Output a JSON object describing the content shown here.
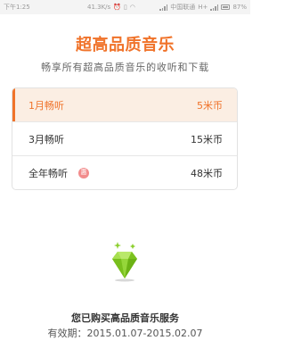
{
  "status_bar": {
    "time": "下午1:25",
    "network_speed": "41.3K/s",
    "carrier": "中国联通",
    "network_type": "H+",
    "battery": "87%"
  },
  "header": {
    "title": "超高品质音乐",
    "subtitle": "畅享所有超高品质音乐的收听和下载"
  },
  "options": [
    {
      "label": "1月畅听",
      "price": "5米币",
      "selected": true
    },
    {
      "label": "3月畅听",
      "price": "15米币",
      "selected": false
    },
    {
      "label": "全年畅听",
      "price": "48米币",
      "selected": false,
      "badge": "惠"
    }
  ],
  "status": {
    "purchased_text": "您已购买高品质音乐服务",
    "validity_text": "有效期：2015.01.07-2015.02.07"
  },
  "colors": {
    "accent": "#f0732a",
    "selected_bg": "#fbeee3",
    "gem": "#8ccf2d"
  }
}
